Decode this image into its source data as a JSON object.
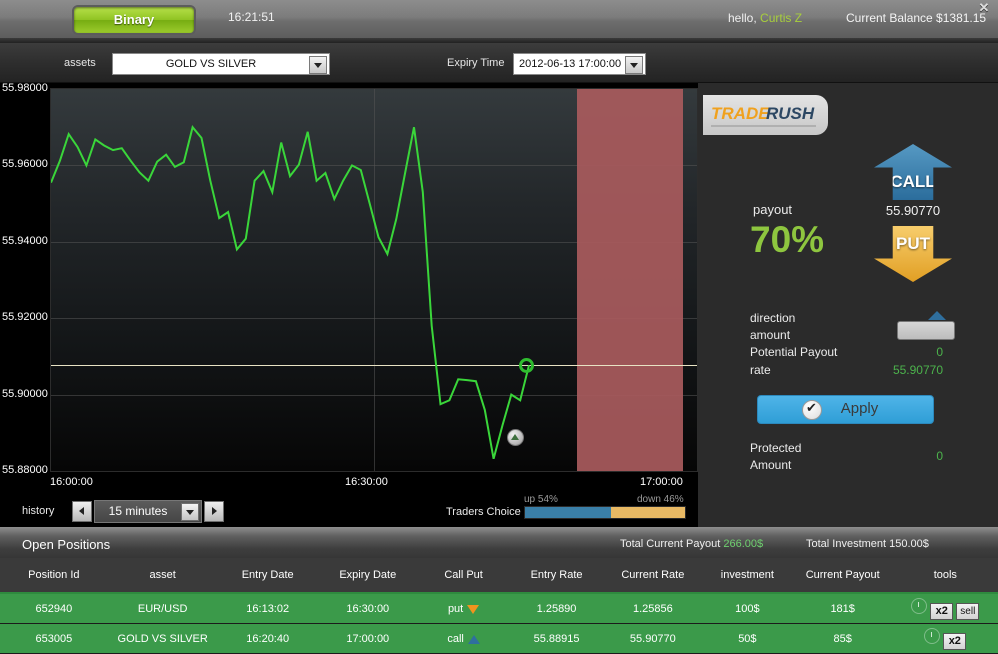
{
  "topbar": {
    "binary_label": "Binary",
    "clock": "16:21:51",
    "greeting": "hello, ",
    "username": "Curtis Z",
    "balance": "Current Balance $1381.15",
    "close_icon": "✕"
  },
  "assetbar": {
    "assets_label": "assets",
    "asset_selected": "GOLD VS SILVER",
    "expiry_label": "Expiry Time",
    "expiry_selected": "2012-06-13 17:00:00"
  },
  "history": {
    "label": "history",
    "timeframe": "15 minutes",
    "traders_choice_label": "Traders Choice",
    "up_label": "up 54%",
    "down_label": "down 46%",
    "up_pct": 54,
    "down_pct": 46
  },
  "panel": {
    "logo_part1": "TRADE",
    "logo_part2": "RUSH",
    "call_label": "CALL",
    "put_label": "PUT",
    "payout_label": "payout",
    "payout_pct": "70%",
    "mid_rate": "55.90770",
    "direction_label": "direction",
    "amount_label": "amount",
    "amount_value": "",
    "potential_payout_label": "Potential Payout",
    "potential_payout_value": "0",
    "rate_label": "rate",
    "rate_value": "55.90770",
    "apply_label": "Apply",
    "protected_label_1": "Protected",
    "protected_label_2": "Amount",
    "protected_value": "0"
  },
  "positions": {
    "title": "Open Positions",
    "total_payout_label": "Total Current Payout ",
    "total_payout_value": "266.00$",
    "total_investment": "Total Investment 150.00$",
    "columns": [
      "Position Id",
      "asset",
      "Entry Date",
      "Expiry Date",
      "Call Put",
      "Entry Rate",
      "Current Rate",
      "investment",
      "Current Payout",
      "tools"
    ],
    "rows": [
      {
        "id": "652940",
        "asset": "EUR/USD",
        "entry_date": "16:13:02",
        "expiry_date": "16:30:00",
        "call_put": "put",
        "dir": "down",
        "entry_rate": "1.25890",
        "current_rate": "1.25856",
        "investment": "100$",
        "current_payout": "181$",
        "x2": "x2",
        "sell": "sell",
        "has_sell": true
      },
      {
        "id": "653005",
        "asset": "GOLD VS SILVER",
        "entry_date": "16:20:40",
        "expiry_date": "17:00:00",
        "call_put": "call",
        "dir": "up",
        "entry_rate": "55.88915",
        "current_rate": "55.90770",
        "investment": "50$",
        "current_payout": "85$",
        "x2": "x2",
        "sell": "",
        "has_sell": false
      }
    ]
  },
  "chart_data": {
    "type": "line",
    "title": "GOLD VS SILVER",
    "xlabel": "",
    "ylabel": "",
    "grid": true,
    "ylim": [
      55.88,
      55.98
    ],
    "ytick_labels": [
      "55.98000",
      "55.96000",
      "55.94000",
      "55.92000",
      "55.90000",
      "55.88000"
    ],
    "yticks": [
      55.98,
      55.96,
      55.94,
      55.92,
      55.9,
      55.88
    ],
    "xtick_labels": [
      "16:00:00",
      "16:30:00",
      "17:00:00"
    ],
    "xticks": [
      0,
      0.5,
      1.0
    ],
    "line_color": "#3ad63a",
    "current_rate": 55.9077,
    "entry_rate": 55.88915,
    "rate_line_value": 55.9077,
    "rate_line_color": "#e8e3c4",
    "expiry_zone": {
      "start": 0.815,
      "end": 0.978,
      "color": "#a85a5c"
    },
    "markers": [
      {
        "name": "current-price",
        "x": 0.735,
        "y": 55.9077,
        "style": "green-circle"
      },
      {
        "name": "entry-point",
        "x": 0.716,
        "y": 55.88915,
        "style": "grey-circle-up"
      }
    ],
    "series": [
      {
        "name": "GOLD VS SILVER",
        "values": [
          55.9555,
          55.9612,
          55.9682,
          55.9648,
          55.96,
          55.9668,
          55.9652,
          55.964,
          55.9645,
          55.9612,
          55.9582,
          55.956,
          55.961,
          55.9628,
          55.9596,
          55.9608,
          55.97,
          55.9672,
          55.956,
          55.9462,
          55.9478,
          55.938,
          55.9408,
          55.956,
          55.9585,
          55.953,
          55.966,
          55.9572,
          55.9602,
          55.9688,
          55.956,
          55.958,
          55.9512,
          55.956,
          55.96,
          55.9588,
          55.95,
          55.9412,
          55.9368,
          55.946,
          55.958,
          55.97,
          55.953,
          55.918,
          55.8975,
          55.8985,
          55.904,
          55.9038,
          55.9035,
          55.896,
          55.8832,
          55.892,
          55.9,
          55.8985,
          55.9077
        ]
      }
    ]
  }
}
